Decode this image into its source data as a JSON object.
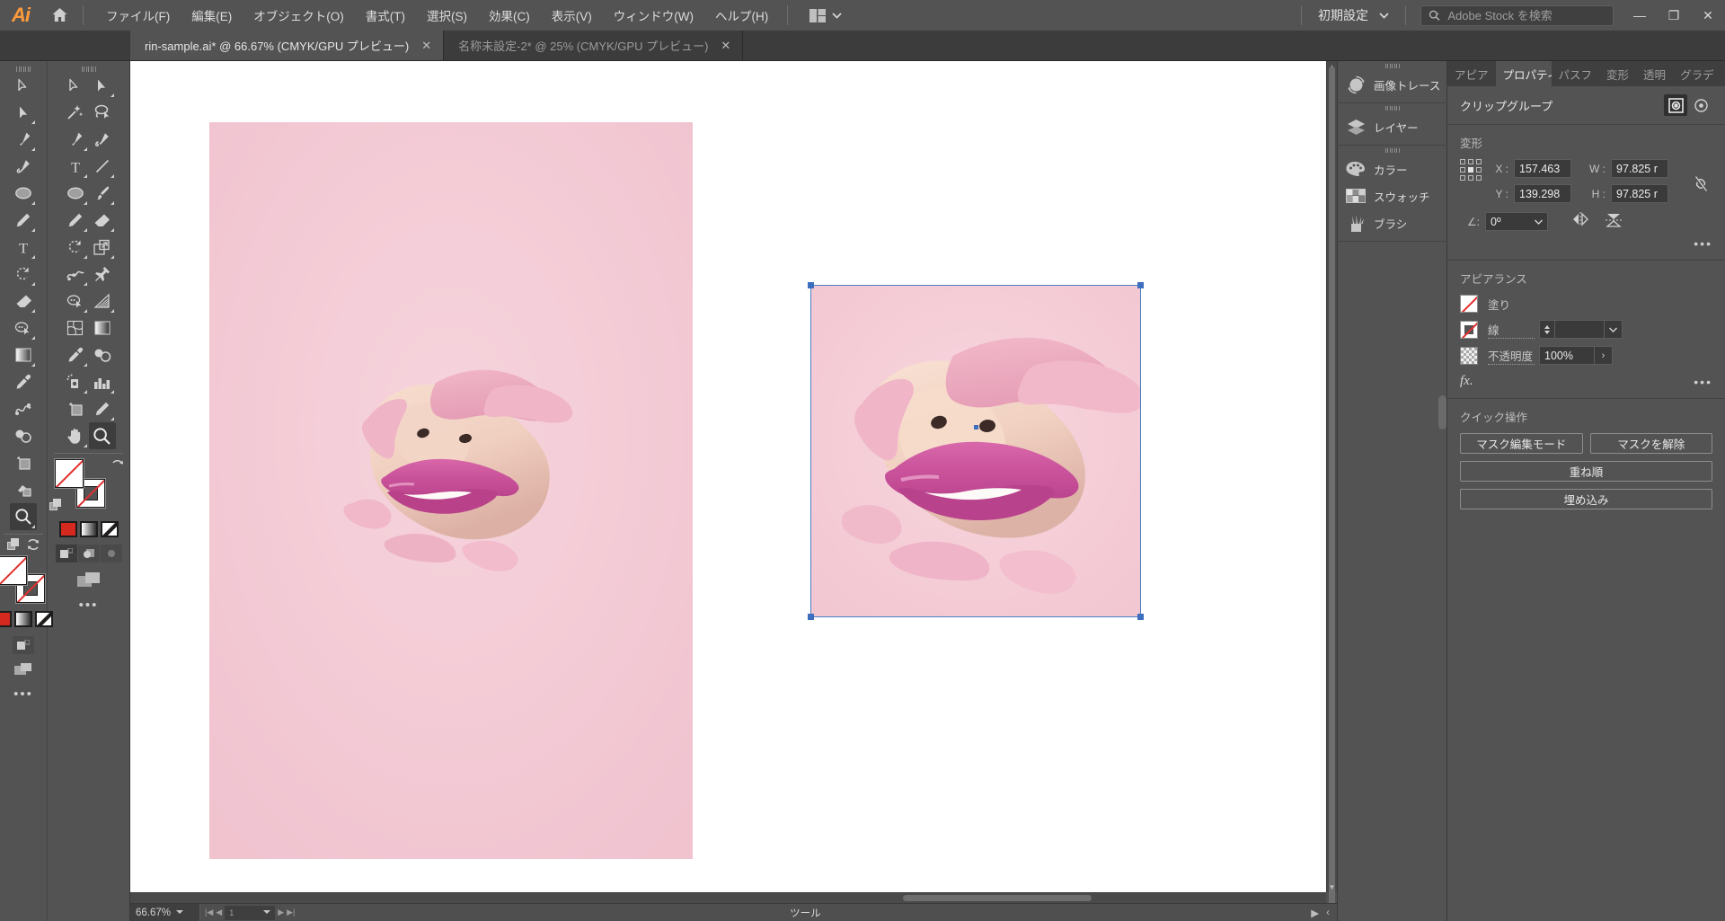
{
  "app": {
    "name": "Adobe Illustrator",
    "logo_text": "Ai",
    "home_icon": "home-icon"
  },
  "menubar": {
    "items": [
      {
        "label": "ファイル(F)"
      },
      {
        "label": "編集(E)"
      },
      {
        "label": "オブジェクト(O)"
      },
      {
        "label": "書式(T)"
      },
      {
        "label": "選択(S)"
      },
      {
        "label": "効果(C)"
      },
      {
        "label": "表示(V)"
      },
      {
        "label": "ウィンドウ(W)"
      },
      {
        "label": "ヘルプ(H)"
      }
    ],
    "arrange_documents_icon": "arrange-documents-icon",
    "workspace": "初期設定",
    "search_placeholder": "Adobe Stock を検索",
    "search_value": "",
    "window_controls": {
      "minimize": "—",
      "restore": "❐",
      "close": "✕"
    }
  },
  "tabs": [
    {
      "label": "rin-sample.ai* @ 66.67% (CMYK/GPU プレビュー)",
      "active": true,
      "close": "✕"
    },
    {
      "label": "名称未設定-2* @ 25% (CMYK/GPU プレビュー)",
      "active": false,
      "close": "✕"
    }
  ],
  "toolbar": {
    "column_one": [
      {
        "name": "selection-tool",
        "icon": "arrow-cursor-icon",
        "flyout": false
      },
      {
        "name": "direct-selection-tool",
        "icon": "direct-arrow-icon",
        "flyout": true
      },
      {
        "name": "pen-tool",
        "icon": "pen-icon",
        "flyout": true
      },
      {
        "name": "curvature-tool",
        "icon": "curvature-icon",
        "flyout": false
      },
      {
        "name": "ellipse-tool",
        "icon": "ellipse-icon",
        "flyout": true
      },
      {
        "name": "pencil-tool",
        "icon": "pencil-icon",
        "flyout": true
      },
      {
        "name": "type-tool",
        "icon": "type-t-icon",
        "flyout": true
      },
      {
        "name": "rotate-tool",
        "icon": "rotate-icon",
        "flyout": true
      },
      {
        "name": "eraser-tool",
        "icon": "eraser-icon",
        "flyout": true
      },
      {
        "name": "shape-builder-tool",
        "icon": "shape-builder-icon",
        "flyout": true
      },
      {
        "name": "gradient-tool",
        "icon": "gradient-icon",
        "flyout": true
      },
      {
        "name": "eyedropper-tool",
        "icon": "eyedropper-icon",
        "flyout": false
      },
      {
        "name": "blend-tool",
        "icon": "blend-icon",
        "flyout": false
      },
      {
        "name": "symbol-sprayer-tool",
        "icon": "symbol-sprayer-icon",
        "flyout": true
      },
      {
        "name": "artboard-tool",
        "icon": "artboard-icon",
        "flyout": false
      },
      {
        "name": "slice-tool",
        "icon": "slice-icon",
        "flyout": true
      },
      {
        "name": "zoom-tool",
        "icon": "magnifier-icon",
        "flyout": true,
        "selected": true
      }
    ],
    "column_two": [
      {
        "name": "selection-tool",
        "icon": "arrow-cursor-icon",
        "flyout": false
      },
      {
        "name": "direct-selection-tool-2",
        "icon": "solid-arrow-icon",
        "flyout": true
      },
      {
        "name": "magic-wand-tool",
        "icon": "magic-wand-icon",
        "flyout": false
      },
      {
        "name": "lasso-tool",
        "icon": "lasso-icon",
        "flyout": false
      },
      {
        "name": "pen-tool-2",
        "icon": "pen-icon",
        "flyout": true
      },
      {
        "name": "add-anchor-tool",
        "icon": "pen-curve-icon",
        "flyout": false
      },
      {
        "name": "type-tool-2",
        "icon": "type-t-icon",
        "flyout": true
      },
      {
        "name": "line-segment-tool",
        "icon": "line-icon",
        "flyout": true
      },
      {
        "name": "ellipse-tool-2",
        "icon": "ellipse-icon",
        "flyout": true
      },
      {
        "name": "paintbrush-tool",
        "icon": "paintbrush-icon",
        "flyout": true
      },
      {
        "name": "pencil-tool-2",
        "icon": "pencil-icon",
        "flyout": true
      },
      {
        "name": "eraser-tool-2",
        "icon": "eraser-icon",
        "flyout": true
      },
      {
        "name": "rotate-tool-2",
        "icon": "rotate-icon",
        "flyout": true
      },
      {
        "name": "scale-tool",
        "icon": "scale-icon",
        "flyout": true
      },
      {
        "name": "width-tool",
        "icon": "width-icon",
        "flyout": true
      },
      {
        "name": "free-transform-tool",
        "icon": "pin-icon",
        "flyout": false
      },
      {
        "name": "shape-builder-tool-2",
        "icon": "shape-builder-icon",
        "flyout": true
      },
      {
        "name": "perspective-grid-tool",
        "icon": "perspective-grid-icon",
        "flyout": true
      },
      {
        "name": "mesh-tool",
        "icon": "mesh-icon",
        "flyout": false
      },
      {
        "name": "gradient-tool-2",
        "icon": "gradient-icon",
        "flyout": false
      },
      {
        "name": "eyedropper-tool-2",
        "icon": "eyedropper-icon",
        "flyout": true
      },
      {
        "name": "blend-tool-2",
        "icon": "blend-icon",
        "flyout": false
      },
      {
        "name": "symbol-sprayer-tool-2",
        "icon": "symbol-sprayer-icon",
        "flyout": true
      },
      {
        "name": "column-graph-tool",
        "icon": "bar-chart-icon",
        "flyout": true
      },
      {
        "name": "artboard-tool-2",
        "icon": "artboard-icon",
        "flyout": false
      },
      {
        "name": "slice-tool-2",
        "icon": "slice-knife-icon",
        "flyout": true
      },
      {
        "name": "hand-tool",
        "icon": "hand-icon",
        "flyout": true
      },
      {
        "name": "zoom-tool-2",
        "icon": "magnifier-icon",
        "flyout": false,
        "selected": true
      }
    ],
    "fill_swatch": "none",
    "stroke_swatch": "none",
    "color_modes": [
      "color-swatch-red",
      "gradient-swatch",
      "none-swatch"
    ],
    "draw_modes": [
      "draw-normal",
      "draw-behind",
      "draw-inside"
    ],
    "screen_mode_icon": "screen-mode-icon",
    "more_tools": "•••"
  },
  "canvas": {
    "artboard_left": {
      "name": "artboard-1",
      "background": "#f3c9d4"
    },
    "artboard_right": {
      "name": "artboard-2-selected",
      "background": "#f5cdd8"
    },
    "selection_color": "#3e6fbf"
  },
  "statusbar": {
    "zoom": "66.67%",
    "page": "1",
    "tool_label": "ツール",
    "prev_icons": [
      "first-page-icon",
      "prev-page-icon"
    ],
    "next_icons": [
      "next-page-icon",
      "last-page-icon"
    ]
  },
  "dock": {
    "groups": [
      {
        "items": [
          {
            "label": "画像トレース",
            "icon": "image-trace-icon"
          }
        ]
      },
      {
        "items": [
          {
            "label": "レイヤー",
            "icon": "layers-icon"
          }
        ]
      },
      {
        "items": [
          {
            "label": "カラー",
            "icon": "color-palette-icon"
          },
          {
            "label": "スウォッチ",
            "icon": "swatches-icon"
          },
          {
            "label": "ブラシ",
            "icon": "brushes-icon"
          }
        ]
      }
    ]
  },
  "properties": {
    "tabs": [
      {
        "label": "アピア",
        "active": false
      },
      {
        "label": "プロパティ",
        "active": true
      },
      {
        "label": "パスフ",
        "active": false
      },
      {
        "label": "変形",
        "active": false
      },
      {
        "label": "透明",
        "active": false
      },
      {
        "label": "グラデ",
        "active": false
      }
    ],
    "object_name": "クリップグループ",
    "object_actions": [
      {
        "name": "isolate-mode-icon",
        "active": true
      },
      {
        "name": "target-icon",
        "active": false
      }
    ],
    "transform": {
      "title": "変形",
      "x_label": "X :",
      "x_value": "157.463",
      "y_label": "Y :",
      "y_value": "139.298",
      "w_label": "W :",
      "w_value": "97.825 r",
      "h_label": "H :",
      "h_value": "97.825 r",
      "angle_label": "∠:",
      "angle_value": "0º",
      "link_icon": "unlink-icon",
      "flip_h_icon": "flip-horizontal-icon",
      "flip_v_icon": "flip-vertical-icon",
      "more_icon": "more-options-icon"
    },
    "appearance": {
      "title": "アピアランス",
      "fill_label": "塗り",
      "fill_value": "none",
      "stroke_label": "線",
      "stroke_weight": "",
      "opacity_label": "不透明度",
      "opacity_value": "100%",
      "fx_label": "fx.",
      "more_icon": "more-options-icon"
    },
    "quick_actions": {
      "title": "クイック操作",
      "buttons": [
        {
          "label": "マスク編集モード"
        },
        {
          "label": "マスクを解除"
        },
        {
          "label": "重ね順"
        },
        {
          "label": "埋め込み"
        }
      ]
    }
  },
  "colors": {
    "chrome": "#535353",
    "chrome_dark": "#3c3c3c",
    "accent_orange": "#ff9a3c",
    "selection_blue": "#3e6fbf",
    "artboard_pink": "#f3c9d4",
    "lip_pink": "#cf5fa3"
  }
}
